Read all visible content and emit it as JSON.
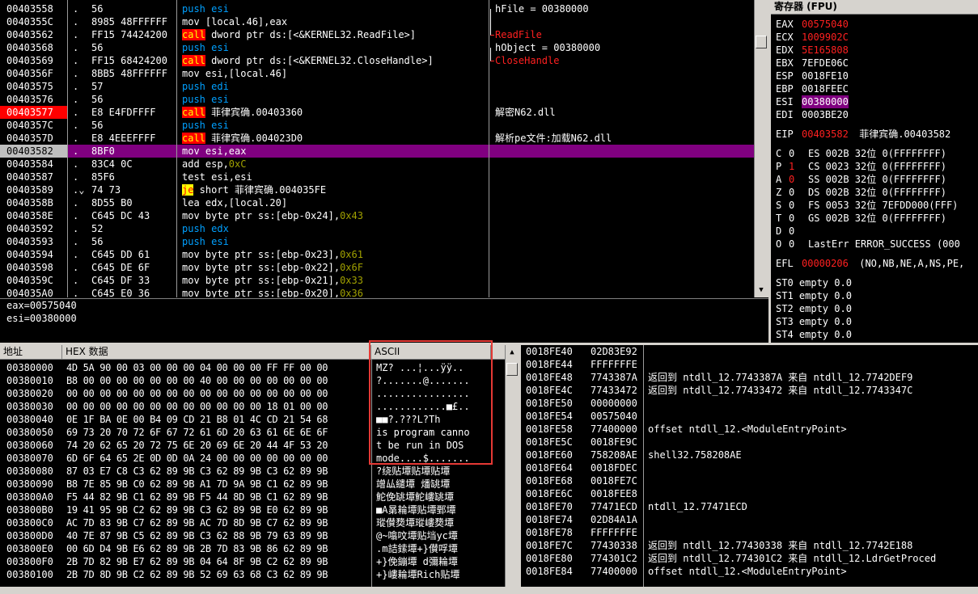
{
  "disasm": {
    "rows": [
      {
        "addr": "00403558",
        "flag": ".",
        "bytes": "56",
        "instr": [
          {
            "t": "push esi",
            "c": "push"
          }
        ],
        "comment": "hFile = 00380000",
        "ccls": ""
      },
      {
        "addr": "0040355C",
        "flag": ".",
        "bytes": "8985 48FFFFFF",
        "instr": [
          {
            "t": "mov [local.46],eax",
            "c": ""
          }
        ],
        "comment": "",
        "ccls": ""
      },
      {
        "addr": "00403562",
        "flag": ".",
        "bytes": "FF15 74424200",
        "instr": [
          {
            "t": "call",
            "c": "call"
          },
          {
            "t": " dword ptr ds:[<&KERNEL32.ReadFile>]",
            "c": ""
          }
        ],
        "comment": "ReadFile",
        "ccls": "red"
      },
      {
        "addr": "00403568",
        "flag": ".",
        "bytes": "56",
        "instr": [
          {
            "t": "push esi",
            "c": "push"
          }
        ],
        "comment": "hObject = 00380000",
        "ccls": ""
      },
      {
        "addr": "00403569",
        "flag": ".",
        "bytes": "FF15 68424200",
        "instr": [
          {
            "t": "call",
            "c": "call"
          },
          {
            "t": " dword ptr ds:[<&KERNEL32.CloseHandle>]",
            "c": ""
          }
        ],
        "comment": "CloseHandle",
        "ccls": "red"
      },
      {
        "addr": "0040356F",
        "flag": ".",
        "bytes": "8BB5 48FFFFFF",
        "instr": [
          {
            "t": "mov esi,[local.46]",
            "c": ""
          }
        ],
        "comment": "",
        "ccls": ""
      },
      {
        "addr": "00403575",
        "flag": ".",
        "bytes": "57",
        "instr": [
          {
            "t": "push edi",
            "c": "push"
          }
        ],
        "comment": "",
        "ccls": ""
      },
      {
        "addr": "00403576",
        "flag": ".",
        "bytes": "56",
        "instr": [
          {
            "t": "push esi",
            "c": "push"
          }
        ],
        "comment": "",
        "ccls": ""
      },
      {
        "addr": "00403577",
        "flag": ".",
        "bytes": "E8 E4FDFFFF",
        "instr": [
          {
            "t": "call",
            "c": "call"
          },
          {
            "t": " 菲律宾确.00403360",
            "c": ""
          }
        ],
        "comment": "解密N62.dll",
        "ccls": "",
        "bp": true
      },
      {
        "addr": "0040357C",
        "flag": ".",
        "bytes": "56",
        "instr": [
          {
            "t": "push esi",
            "c": "push"
          }
        ],
        "comment": "",
        "ccls": ""
      },
      {
        "addr": "0040357D",
        "flag": ".",
        "bytes": "E8 4EEEFFFF",
        "instr": [
          {
            "t": "call",
            "c": "call"
          },
          {
            "t": " 菲律宾确.004023D0",
            "c": ""
          }
        ],
        "comment": "解析pe文件:加载N62.dll",
        "ccls": ""
      },
      {
        "addr": "00403582",
        "flag": ".",
        "bytes": "8BF0",
        "instr": [
          {
            "t": "mov esi,eax",
            "c": ""
          }
        ],
        "comment": "",
        "ccls": "",
        "sel": true
      },
      {
        "addr": "00403584",
        "flag": ".",
        "bytes": "83C4 0C",
        "instr": [
          {
            "t": "add esp,",
            "c": ""
          },
          {
            "t": "0xC",
            "c": "hex"
          }
        ],
        "comment": "",
        "ccls": ""
      },
      {
        "addr": "00403587",
        "flag": ".",
        "bytes": "85F6",
        "instr": [
          {
            "t": "test esi,esi",
            "c": ""
          }
        ],
        "comment": "",
        "ccls": ""
      },
      {
        "addr": "00403589",
        "flag": ".⌄",
        "bytes": "74 73",
        "instr": [
          {
            "t": "je",
            "c": "jmp"
          },
          {
            "t": " short 菲律宾确.004035FE",
            "c": ""
          }
        ],
        "comment": "",
        "ccls": ""
      },
      {
        "addr": "0040358B",
        "flag": ".",
        "bytes": "8D55 B0",
        "instr": [
          {
            "t": "lea edx,[local.20]",
            "c": ""
          }
        ],
        "comment": "",
        "ccls": ""
      },
      {
        "addr": "0040358E",
        "flag": ".",
        "bytes": "C645 DC 43",
        "instr": [
          {
            "t": "mov byte ptr ss:[ebp-0x24],",
            "c": ""
          },
          {
            "t": "0x43",
            "c": "hex"
          }
        ],
        "comment": "",
        "ccls": ""
      },
      {
        "addr": "00403592",
        "flag": ".",
        "bytes": "52",
        "instr": [
          {
            "t": "push edx",
            "c": "push"
          }
        ],
        "comment": "",
        "ccls": ""
      },
      {
        "addr": "00403593",
        "flag": ".",
        "bytes": "56",
        "instr": [
          {
            "t": "push esi",
            "c": "push"
          }
        ],
        "comment": "",
        "ccls": ""
      },
      {
        "addr": "00403594",
        "flag": ".",
        "bytes": "C645 DD 61",
        "instr": [
          {
            "t": "mov byte ptr ss:[ebp-0x23],",
            "c": ""
          },
          {
            "t": "0x61",
            "c": "hex"
          }
        ],
        "comment": "",
        "ccls": ""
      },
      {
        "addr": "00403598",
        "flag": ".",
        "bytes": "C645 DE 6F",
        "instr": [
          {
            "t": "mov byte ptr ss:[ebp-0x22],",
            "c": ""
          },
          {
            "t": "0x6F",
            "c": "hex"
          }
        ],
        "comment": "",
        "ccls": ""
      },
      {
        "addr": "0040359C",
        "flag": ".",
        "bytes": "C645 DF 33",
        "instr": [
          {
            "t": "mov byte ptr ss:[ebp-0x21],",
            "c": ""
          },
          {
            "t": "0x33",
            "c": "hex"
          }
        ],
        "comment": "",
        "ccls": ""
      },
      {
        "addr": "004035A0",
        "flag": ".",
        "bytes": "C645 E0 36",
        "instr": [
          {
            "t": "mov byte ptr ss:[ebp-0x20],",
            "c": ""
          },
          {
            "t": "0x36",
            "c": "hex"
          }
        ],
        "comment": "",
        "ccls": ""
      }
    ]
  },
  "info": {
    "lines": [
      "eax=00575040",
      "esi=00380000"
    ]
  },
  "registers": {
    "title": "寄存器 (FPU)",
    "gp": [
      {
        "n": "EAX",
        "v": "00575040",
        "c": "red"
      },
      {
        "n": "ECX",
        "v": "1009902C",
        "c": "red"
      },
      {
        "n": "EDX",
        "v": "5E165808",
        "c": "red"
      },
      {
        "n": "EBX",
        "v": "7EFDE06C",
        "c": ""
      },
      {
        "n": "ESP",
        "v": "0018FE10",
        "c": ""
      },
      {
        "n": "EBP",
        "v": "0018FEEC",
        "c": ""
      },
      {
        "n": "ESI",
        "v": "00380000",
        "c": "sel"
      },
      {
        "n": "EDI",
        "v": "0003BE20",
        "c": ""
      }
    ],
    "eip": {
      "n": "EIP",
      "v": "00403582",
      "rest": " 菲律宾确.00403582"
    },
    "flags": [
      {
        "f": "C",
        "b": "0",
        "seg": "ES 002B 32位 0(FFFFFFFF)",
        "red": false
      },
      {
        "f": "P",
        "b": "1",
        "seg": "CS 0023 32位 0(FFFFFFFF)",
        "red": true
      },
      {
        "f": "A",
        "b": "0",
        "seg": "SS 002B 32位 0(FFFFFFFF)",
        "red": true
      },
      {
        "f": "Z",
        "b": "0",
        "seg": "DS 002B 32位 0(FFFFFFFF)",
        "red": false
      },
      {
        "f": "S",
        "b": "0",
        "seg": "FS 0053 32位 7EFDD000(FFF)",
        "red": false
      },
      {
        "f": "T",
        "b": "0",
        "seg": "GS 002B 32位 0(FFFFFFFF)",
        "red": false
      },
      {
        "f": "D",
        "b": "0",
        "seg": "",
        "red": false
      },
      {
        "f": "O",
        "b": "0",
        "seg": "LastErr ERROR_SUCCESS (000",
        "red": false
      }
    ],
    "efl": {
      "n": "EFL",
      "v": "00000206",
      "rest": " (NO,NB,NE,A,NS,PE,"
    },
    "st": [
      "ST0 empty 0.0",
      "ST1 empty 0.0",
      "ST2 empty 0.0",
      "ST3 empty 0.0",
      "ST4 empty 0.0"
    ]
  },
  "dump": {
    "header_addr": "地址",
    "header_hex": "HEX 数据",
    "header_ascii": "ASCII",
    "rows": [
      {
        "a": "00380000",
        "h": "4D 5A 90 00 03 00 00 00 04 00 00 00 FF FF 00 00",
        "s": "MZ? ...¦...ÿÿ.."
      },
      {
        "a": "00380010",
        "h": "B8 00 00 00 00 00 00 00 40 00 00 00 00 00 00 00",
        "s": "?.......@......."
      },
      {
        "a": "00380020",
        "h": "00 00 00 00 00 00 00 00 00 00 00 00 00 00 00 00",
        "s": "................"
      },
      {
        "a": "00380030",
        "h": "00 00 00 00 00 00 00 00 00 00 00 00 18 01 00 00",
        "s": "............■£.."
      },
      {
        "a": "00380040",
        "h": "0E 1F BA 0E 00 B4 09 CD 21 B8 01 4C CD 21 54 68",
        "s": "■■?.???L?Th"
      },
      {
        "a": "00380050",
        "h": "69 73 20 70 72 6F 67 72 61 6D 20 63 61 6E 6E 6F",
        "s": "is program canno"
      },
      {
        "a": "00380060",
        "h": "74 20 62 65 20 72 75 6E 20 69 6E 20 44 4F 53 20",
        "s": "t be run in DOS "
      },
      {
        "a": "00380070",
        "h": "6D 6F 64 65 2E 0D 0D 0A 24 00 00 00 00 00 00 00",
        "s": "mode....$......."
      },
      {
        "a": "00380080",
        "h": "87 03 E7 C8 C3 62 89 9B C3 62 89 9B C3 62 89 9B",
        "s": "?绕贴墰贴墰贴墰"
      },
      {
        "a": "00380090",
        "h": "B8 7E 85 9B C0 62 89 9B A1 7D 9A 9B C1 62 89 9B",
        "s": "竲厸繾墰 燔罀墰"
      },
      {
        "a": "003800A0",
        "h": "F5 44 82 9B C1 62 89 9B F5 44 8D 9B C1 62 89 9B",
        "s": "鮀俛罀墰鮀嶁罀墰"
      },
      {
        "a": "003800B0",
        "h": "19 41 95 9B C2 62 89 9B C3 62 89 9B E0 62 89 9B",
        "s": "■A晜耣墰贴墰鄄墰"
      },
      {
        "a": "003800C0",
        "h": "AC 7D 83 9B C7 62 89 9B AC 7D 8D 9B C7 62 89 9B",
        "s": "瑽儧奦墰瑽嶁奦墰"
      },
      {
        "a": "003800D0",
        "h": "40 7E 87 9B C5 62 89 9B C3 62 88 9B 79 63 89 9B",
        "s": "@~噏呅墰贴垱yc墰"
      },
      {
        "a": "003800E0",
        "h": "00 6D D4 9B E6 62 89 9B 2B 7D 83 9B 86 62 89 9B",
        "s": ".m詰鎍墰+}儧哹墰"
      },
      {
        "a": "003800F0",
        "h": "2B 7D 82 9B E7 62 89 9B 04 64 8F 9B C2 62 89 9B",
        "s": "+}俛鏰墰 d彌耣墰"
      },
      {
        "a": "00380100",
        "h": "2B 7D 8D 9B C2 62 89 9B 52 69 63 68 C3 62 89 9B",
        "s": "+}嶁耣墰Rich贴墰"
      }
    ]
  },
  "stack": {
    "rows": [
      {
        "a": "0018FE40",
        "v": "02D83E92",
        "c": ""
      },
      {
        "a": "0018FE44",
        "v": "FFFFFFFE",
        "c": ""
      },
      {
        "a": "0018FE48",
        "v": "7743387A",
        "c": "返回到 ntdll_12.7743387A 来自 ntdll_12.7742DEF9"
      },
      {
        "a": "0018FE4C",
        "v": "77433472",
        "c": "返回到 ntdll_12.77433472 来自 ntdll_12.7743347C"
      },
      {
        "a": "0018FE50",
        "v": "00000000",
        "c": ""
      },
      {
        "a": "0018FE54",
        "v": "00575040",
        "c": ""
      },
      {
        "a": "0018FE58",
        "v": "77400000",
        "c": "offset ntdll_12.<ModuleEntryPoint>"
      },
      {
        "a": "0018FE5C",
        "v": "0018FE9C",
        "c": ""
      },
      {
        "a": "0018FE60",
        "v": "758208AE",
        "c": "shell32.758208AE"
      },
      {
        "a": "0018FE64",
        "v": "0018FDEC",
        "c": ""
      },
      {
        "a": "0018FE68",
        "v": "0018FE7C",
        "c": ""
      },
      {
        "a": "0018FE6C",
        "v": "0018FEE8",
        "c": ""
      },
      {
        "a": "0018FE70",
        "v": "77471ECD",
        "c": "ntdll_12.77471ECD"
      },
      {
        "a": "0018FE74",
        "v": "02D84A1A",
        "c": ""
      },
      {
        "a": "0018FE78",
        "v": "FFFFFFFE",
        "c": ""
      },
      {
        "a": "0018FE7C",
        "v": "77430338",
        "c": "返回到 ntdll_12.77430338 来自 ntdll_12.7742E188"
      },
      {
        "a": "0018FE80",
        "v": "774301C2",
        "c": "返回到 ntdll_12.774301C2 来自 ntdll_12.LdrGetProced"
      },
      {
        "a": "0018FE84",
        "v": "77400000",
        "c": "offset ntdll_12.<ModuleEntryPoint>"
      }
    ]
  },
  "colors": {
    "highlight_box": "#e53935",
    "selection": "#800080",
    "breakpoint": "#ff0000"
  }
}
